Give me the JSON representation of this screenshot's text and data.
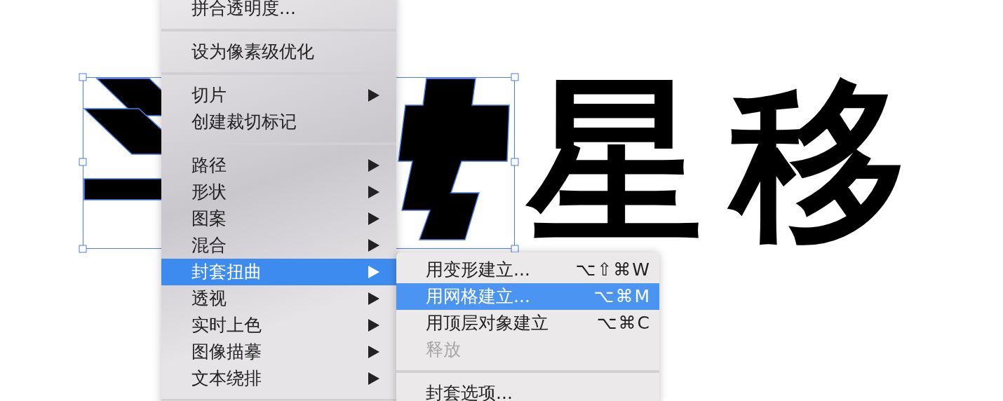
{
  "canvas": {
    "text": "星移"
  },
  "menu": {
    "items": [
      {
        "kind": "item",
        "label": "拼合透明度...",
        "submenu": false,
        "selected": false
      },
      {
        "kind": "separator"
      },
      {
        "kind": "item",
        "label": "设为像素级优化",
        "submenu": false,
        "selected": false
      },
      {
        "kind": "separator"
      },
      {
        "kind": "item",
        "label": "切片",
        "submenu": true,
        "selected": false
      },
      {
        "kind": "item",
        "label": "创建裁切标记",
        "submenu": false,
        "selected": false
      },
      {
        "kind": "separator"
      },
      {
        "kind": "item",
        "label": "路径",
        "submenu": true,
        "selected": false
      },
      {
        "kind": "item",
        "label": "形状",
        "submenu": true,
        "selected": false
      },
      {
        "kind": "item",
        "label": "图案",
        "submenu": true,
        "selected": false
      },
      {
        "kind": "item",
        "label": "混合",
        "submenu": true,
        "selected": false
      },
      {
        "kind": "item",
        "label": "封套扭曲",
        "submenu": true,
        "selected": true
      },
      {
        "kind": "item",
        "label": "透视",
        "submenu": true,
        "selected": false
      },
      {
        "kind": "item",
        "label": "实时上色",
        "submenu": true,
        "selected": false
      },
      {
        "kind": "item",
        "label": "图像描摹",
        "submenu": true,
        "selected": false
      },
      {
        "kind": "item",
        "label": "文本绕排",
        "submenu": true,
        "selected": false
      },
      {
        "kind": "separator"
      }
    ]
  },
  "submenu": {
    "items": [
      {
        "kind": "item",
        "label": "用变形建立...",
        "shortcut": "⌥⇧⌘W",
        "selected": false,
        "disabled": false
      },
      {
        "kind": "item",
        "label": "用网格建立...",
        "shortcut": "⌥⌘M",
        "selected": true,
        "disabled": false
      },
      {
        "kind": "item",
        "label": "用顶层对象建立",
        "shortcut": "⌥⌘C",
        "selected": false,
        "disabled": false
      },
      {
        "kind": "item",
        "label": "释放",
        "selected": false,
        "disabled": true
      },
      {
        "kind": "separator"
      },
      {
        "kind": "item",
        "label": "封套选项...",
        "selected": false,
        "disabled": false
      }
    ]
  }
}
